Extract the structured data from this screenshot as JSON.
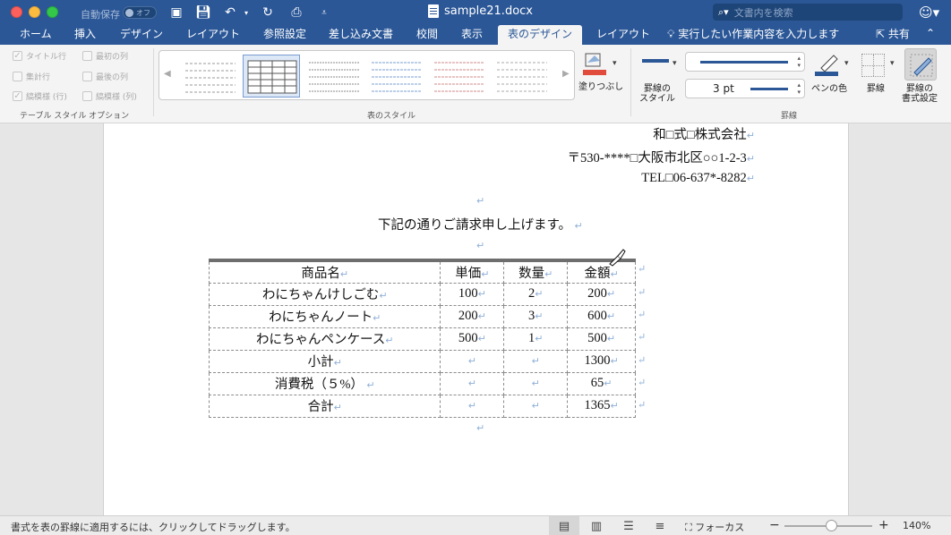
{
  "titlebar": {
    "autosave_label": "自動保存",
    "autosave_state": "オフ",
    "doc_title": "sample21.docx",
    "search_placeholder": "文書内を検索"
  },
  "tabs": [
    "ホーム",
    "挿入",
    "デザイン",
    "レイアウト",
    "参照設定",
    "差し込み文書",
    "校閲",
    "表示",
    "表のデザイン",
    "レイアウト"
  ],
  "active_tab": "表のデザイン",
  "tell_me": "実行したい作業内容を入力します",
  "share": "共有",
  "ribbon": {
    "options": [
      "タイトル行",
      "最初の列",
      "集計行",
      "最後の列",
      "縞模様 (行)",
      "縞模様 (列)"
    ],
    "options_group": "テーブル スタイル オプション",
    "styles_group": "表のスタイル",
    "shading": "塗りつぶし",
    "border_style": "罫線の\nスタイル",
    "pen_weight": "3 pt",
    "pen_color": "ペンの色",
    "borders": "罫線",
    "border_painter": "罫線の\n書式設定",
    "borders_group": "罫線"
  },
  "document": {
    "company": "和□式□株式会社",
    "address": "〒530-****□大阪市北区○○1-2-3",
    "tel": "TEL□06-637*-8282",
    "intro": "下記の通りご請求申し上げます。",
    "table": {
      "headers": [
        "商品名",
        "単価",
        "数量",
        "金額"
      ],
      "rows": [
        [
          "わにちゃんけしごむ",
          "100",
          "2",
          "200"
        ],
        [
          "わにちゃんノート",
          "200",
          "3",
          "600"
        ],
        [
          "わにちゃんペンケース",
          "500",
          "1",
          "500"
        ],
        [
          "小計",
          "",
          "",
          "1300"
        ],
        [
          "消費税（５%）",
          "",
          "",
          "65"
        ],
        [
          "合計",
          "",
          "",
          "1365"
        ]
      ]
    }
  },
  "statusbar": {
    "message": "書式を表の罫線に適用するには、クリックしてドラッグします。",
    "focus": "フォーカス",
    "zoom": "140%"
  }
}
